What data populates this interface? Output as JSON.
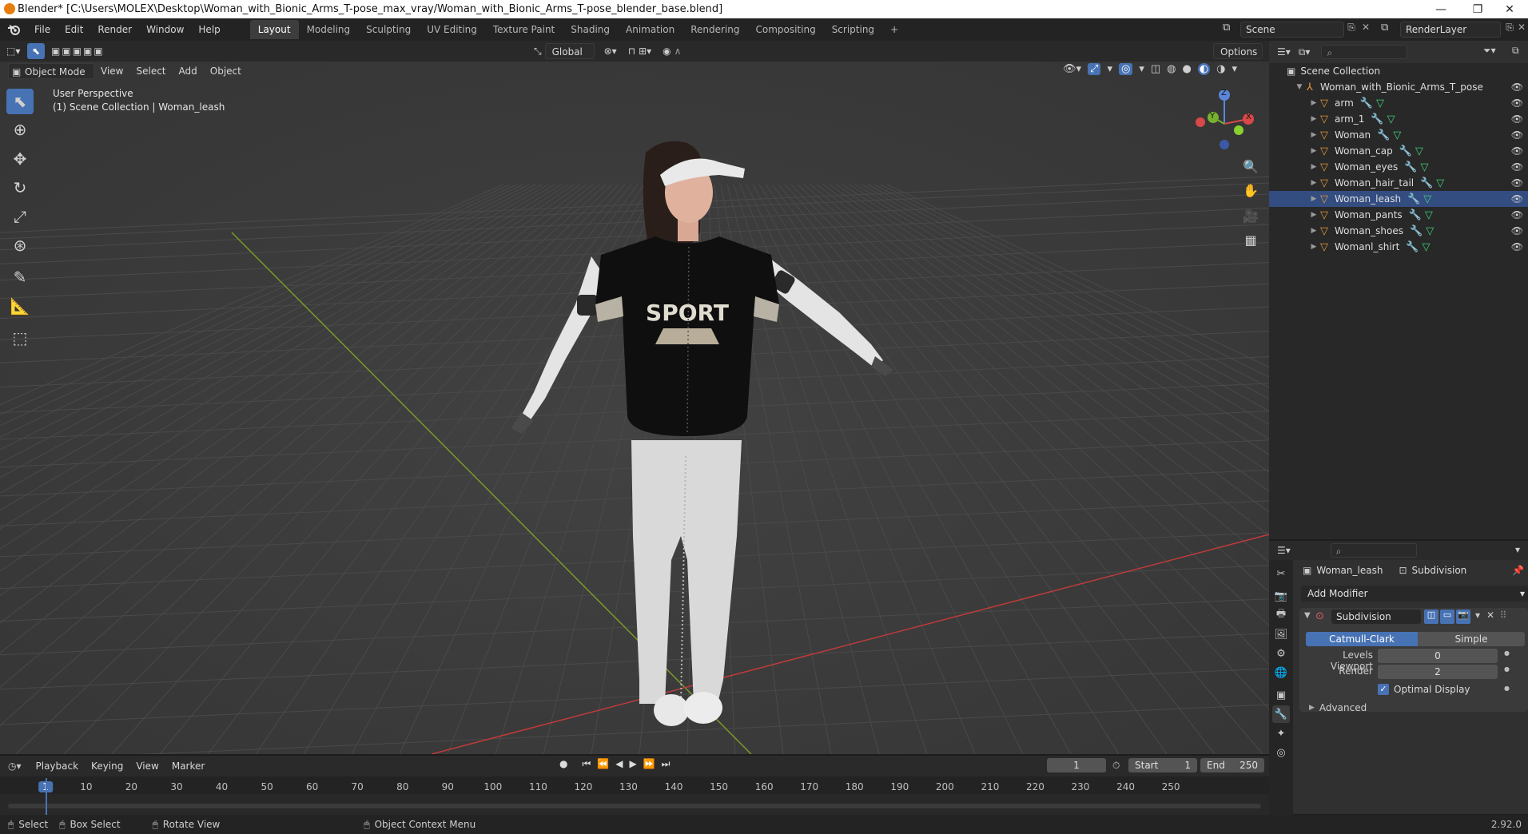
{
  "window": {
    "title": "Blender* [C:\\Users\\MOLEX\\Desktop\\Woman_with_Bionic_Arms_T-pose_max_vray/Woman_with_Bionic_Arms_T-pose_blender_base.blend]",
    "minimize": "—",
    "restore": "❐",
    "close": "✕"
  },
  "menus": [
    "File",
    "Edit",
    "Render",
    "Window",
    "Help"
  ],
  "workspaces": [
    "Layout",
    "Modeling",
    "Sculpting",
    "UV Editing",
    "Texture Paint",
    "Shading",
    "Animation",
    "Rendering",
    "Compositing",
    "Scripting"
  ],
  "workspace_add": "+",
  "scene": {
    "name": "Scene",
    "render_layer": "RenderLayer"
  },
  "viewport": {
    "mode": "Object Mode",
    "menus": [
      "View",
      "Select",
      "Add",
      "Object"
    ],
    "transform_orientation": "Global",
    "options_label": "Options",
    "info_line1": "User Perspective",
    "info_line2": "(1) Scene Collection | Woman_leash",
    "gizmo": {
      "x": "X",
      "y": "Y",
      "z": "Z"
    },
    "grid_color": "#4a4a4a",
    "x_axis_color": "#c03a3a",
    "y_axis_color": "#7a9a2a"
  },
  "outliner": {
    "root": "Scene Collection",
    "collection": "Woman_with_Bionic_Arms_T_pose",
    "items": [
      "arm",
      "arm_1",
      "Woman",
      "Woman_cap",
      "Woman_eyes",
      "Woman_hair_tail",
      "Woman_leash",
      "Woman_pants",
      "Woman_shoes",
      "Womanl_shirt"
    ],
    "selected": "Woman_leash"
  },
  "properties": {
    "object_name": "Woman_leash",
    "modifier_breadcrumb": "Subdivision",
    "add_modifier": "Add Modifier",
    "modifier_name": "Subdivision",
    "type_catmull": "Catmull-Clark",
    "type_simple": "Simple",
    "levels_viewport_label": "Levels Viewport",
    "levels_viewport_value": "0",
    "render_label": "Render",
    "render_value": "2",
    "optimal_display": "Optimal Display",
    "advanced": "Advanced"
  },
  "timeline": {
    "menus": [
      "Playback",
      "Keying",
      "View",
      "Marker"
    ],
    "current_frame": "1",
    "start_label": "Start",
    "start_value": "1",
    "end_label": "End",
    "end_value": "250",
    "ticks": [
      "1",
      "10",
      "20",
      "30",
      "40",
      "50",
      "60",
      "70",
      "80",
      "90",
      "100",
      "110",
      "120",
      "130",
      "140",
      "150",
      "160",
      "170",
      "180",
      "190",
      "200",
      "210",
      "220",
      "230",
      "240",
      "250"
    ]
  },
  "statusbar": {
    "select": "Select",
    "box_select": "Box Select",
    "rotate_view": "Rotate View",
    "context_menu": "Object Context Menu",
    "version": "2.92.0"
  }
}
